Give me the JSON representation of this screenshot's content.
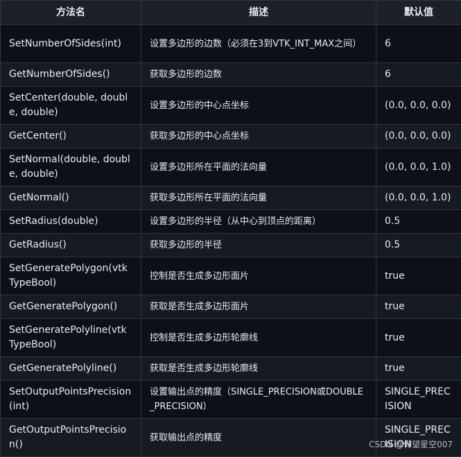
{
  "header": {
    "col_method": "方法名",
    "col_desc": "描述",
    "col_default": "默认值"
  },
  "rows": [
    {
      "method": "SetNumberOfSides(int)",
      "desc": "设置多边形的边数（必须在3到VTK_INT_MAX之间）",
      "default": "6"
    },
    {
      "method": "GetNumberOfSides()",
      "desc": "获取多边形的边数",
      "default": "6"
    },
    {
      "method": "SetCenter(double, double, double)",
      "desc": "设置多边形的中心点坐标",
      "default": "(0.0, 0.0, 0.0)"
    },
    {
      "method": "GetCenter()",
      "desc": "获取多边形的中心点坐标",
      "default": "(0.0, 0.0, 0.0)"
    },
    {
      "method": "SetNormal(double, double, double)",
      "desc": "设置多边形所在平面的法向量",
      "default": "(0.0, 0.0, 1.0)"
    },
    {
      "method": "GetNormal()",
      "desc": "获取多边形所在平面的法向量",
      "default": "(0.0, 0.0, 1.0)"
    },
    {
      "method": "SetRadius(double)",
      "desc": "设置多边形的半径（从中心到顶点的距离）",
      "default": "0.5"
    },
    {
      "method": "GetRadius()",
      "desc": "获取多边形的半径",
      "default": "0.5"
    },
    {
      "method": "SetGeneratePolygon(vtkTypeBool)",
      "desc": "控制是否生成多边形面片",
      "default": "true"
    },
    {
      "method": "GetGeneratePolygon()",
      "desc": "获取是否生成多边形面片",
      "default": "true"
    },
    {
      "method": "SetGeneratePolyline(vtkTypeBool)",
      "desc": "控制是否生成多边形轮廓线",
      "default": "true"
    },
    {
      "method": "GetGeneratePolyline()",
      "desc": "获取是否生成多边形轮廓线",
      "default": "true"
    },
    {
      "method": "SetOutputPointsPrecision(int)",
      "desc": "设置输出点的精度（SINGLE_PRECISION或DOUBLE_PRECISION）",
      "default": "SINGLE_PRECISION"
    },
    {
      "method": "GetOutputPointsPrecision()",
      "desc": "获取输出点的精度",
      "default": "SINGLE_PRECISION"
    }
  ],
  "watermark": "CSDN @仰望星空007"
}
